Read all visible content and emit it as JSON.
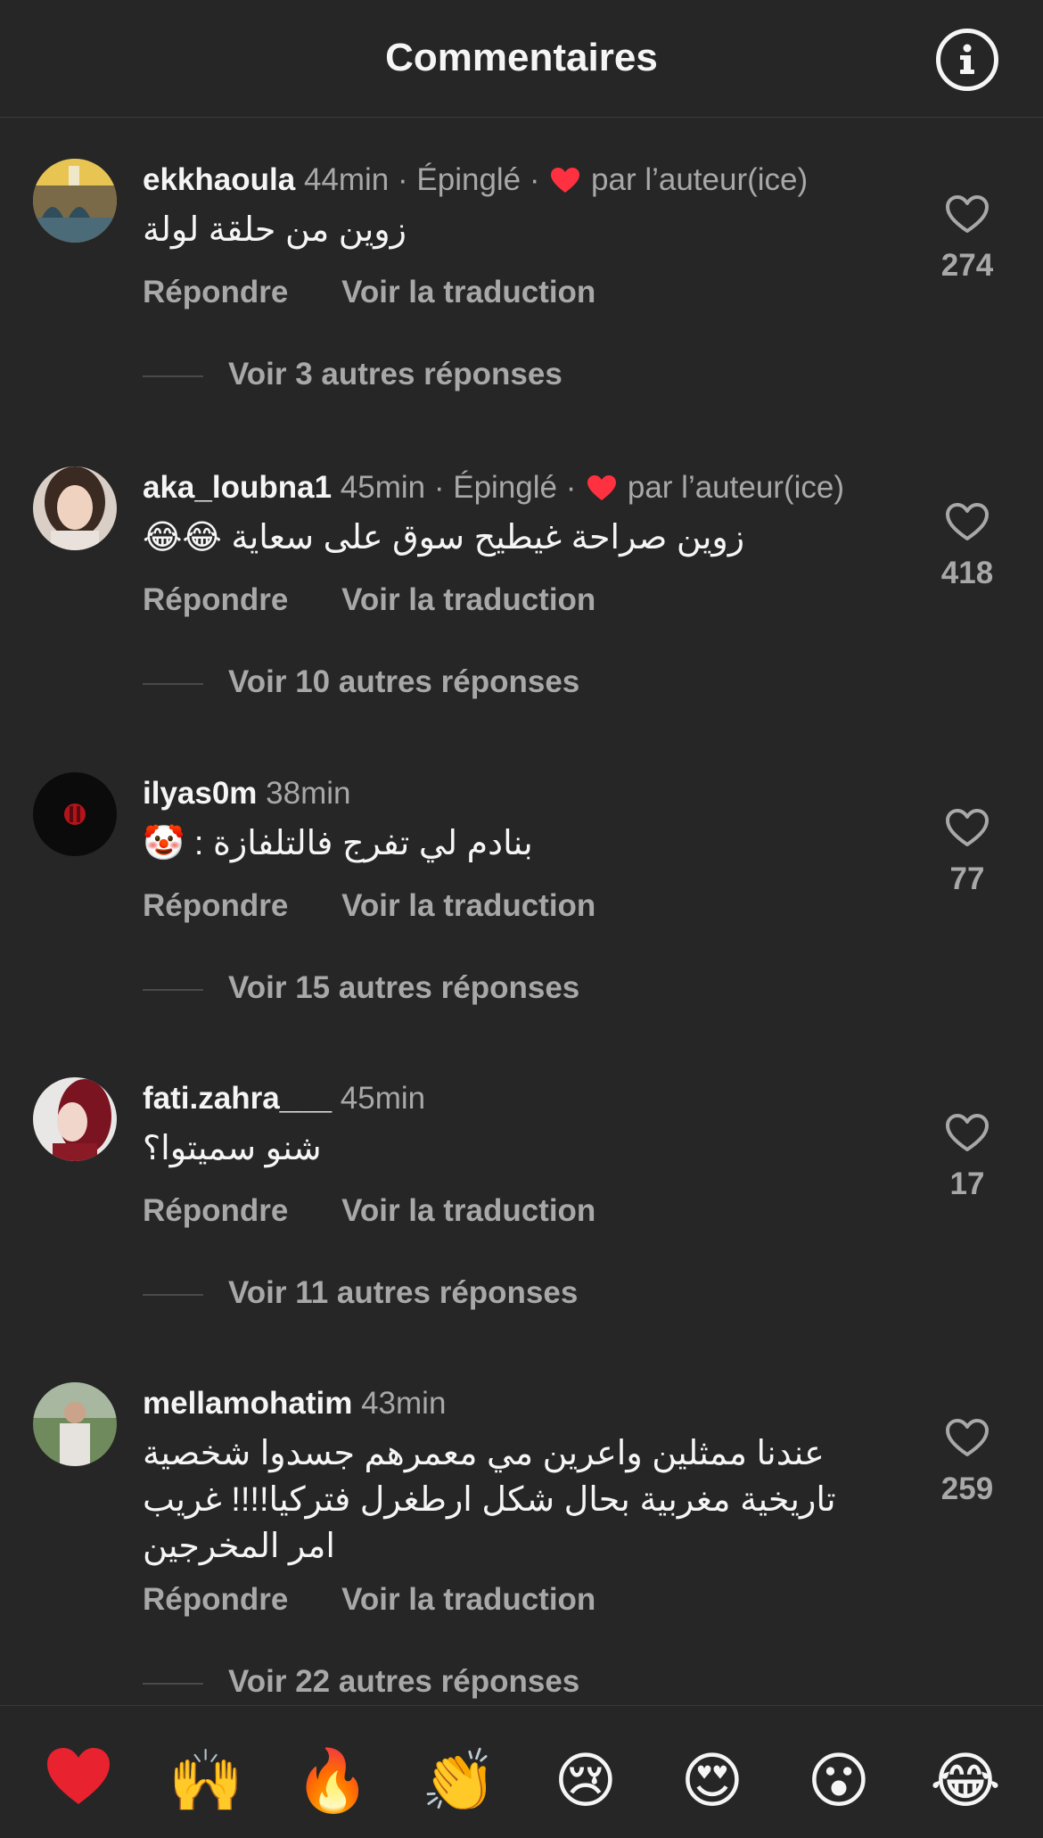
{
  "header": {
    "title": "Commentaires"
  },
  "comments": [
    {
      "username": "ekkhaoula",
      "time": "44min",
      "pinned": "Épinglé",
      "by_author": "par l’auteur(ice)",
      "text": "زوين من حلقة لولة",
      "reply_label": "Répondre",
      "translate_label": "Voir la traduction",
      "replies_label": "Voir 3 autres réponses",
      "likes": "274"
    },
    {
      "username": "aka_loubna1",
      "time": "45min",
      "pinned": "Épinglé",
      "by_author": "par l’auteur(ice)",
      "text": "زوين صراحة غيطيح سوق على سعاية 😂😂",
      "reply_label": "Répondre",
      "translate_label": "Voir la traduction",
      "replies_label": "Voir 10 autres réponses",
      "likes": "418"
    },
    {
      "username": "ilyas0m",
      "time": "38min",
      "text": "بنادم لي تفرج فالتلفازة : 🤡",
      "reply_label": "Répondre",
      "translate_label": "Voir la traduction",
      "replies_label": "Voir 15 autres réponses",
      "likes": "77"
    },
    {
      "username": "fati.zahra___",
      "time": "45min",
      "text": "شنو سميتوا؟",
      "reply_label": "Répondre",
      "translate_label": "Voir la traduction",
      "replies_label": "Voir 11 autres réponses",
      "likes": "17"
    },
    {
      "username": "mellamohatim",
      "time": "43min",
      "text": "عندنا ممثلين واعرين مي معمرهم جسدوا شخصية تاريخية مغربية بحال شكل ارطغرل فتركيا!!!! غريب امر المخرجين",
      "reply_label": "Répondre",
      "translate_label": "Voir la traduction",
      "replies_label": "Voir 22 autres réponses",
      "likes": "259"
    }
  ],
  "separator": "·",
  "emoji_bar": {
    "items": [
      "❤️",
      "🙌",
      "🔥",
      "👏",
      "😢",
      "😍",
      "😮",
      "😂"
    ]
  },
  "colors": {
    "background": "#262626",
    "text": "#f5f5f5",
    "secondary": "#a8a8a8",
    "heart_red": "#ff3040"
  }
}
